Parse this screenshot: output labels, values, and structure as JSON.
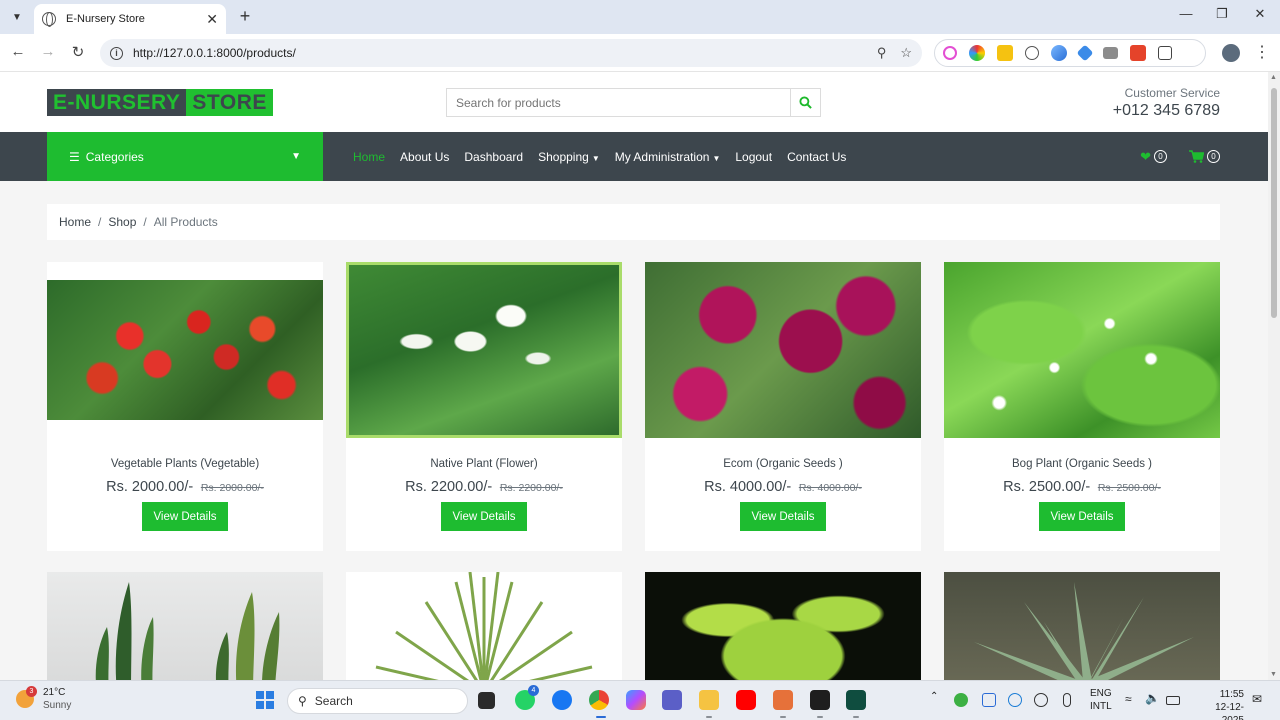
{
  "browser": {
    "tab_title": "E-Nursery Store",
    "url": "http://127.0.0.1:8000/products/"
  },
  "header": {
    "logo_part1": "E-NURSERY",
    "logo_part2": "STORE",
    "search_placeholder": "Search for products",
    "customer_service_label": "Customer Service",
    "phone": "+012 345 6789"
  },
  "navbar": {
    "categories_label": "Categories",
    "links": [
      "Home",
      "About Us",
      "Dashboard",
      "Shopping",
      "My Administration",
      "Logout",
      "Contact Us"
    ],
    "wishlist_count": "0",
    "cart_count": "0"
  },
  "breadcrumb": [
    "Home",
    "Shop",
    "All Products"
  ],
  "products": [
    {
      "name": "Vegetable Plants (Vegetable)",
      "price": "Rs. 2000.00/-",
      "old_price": "Rs. 2000.00/-",
      "button": "View Details"
    },
    {
      "name": "Native Plant (Flower)",
      "price": "Rs. 2200.00/-",
      "old_price": "Rs. 2200.00/-",
      "button": "View Details"
    },
    {
      "name": "Ecom (Organic Seeds )",
      "price": "Rs. 4000.00/-",
      "old_price": "Rs. 4000.00/-",
      "button": "View Details"
    },
    {
      "name": "Bog Plant (Organic Seeds )",
      "price": "Rs. 2500.00/-",
      "old_price": "Rs. 2500.00/-",
      "button": "View Details"
    }
  ],
  "colors": {
    "accent_green": "#1ebc30",
    "dark": "#3d464d"
  },
  "taskbar": {
    "weather_temp": "21°C",
    "weather_desc": "Sunny",
    "weather_badge": "3",
    "search_label": "Search",
    "whatsapp_badge": "4",
    "language": "ENG",
    "layout": "INTL",
    "time": "11:55",
    "date": "12-12-2025"
  }
}
